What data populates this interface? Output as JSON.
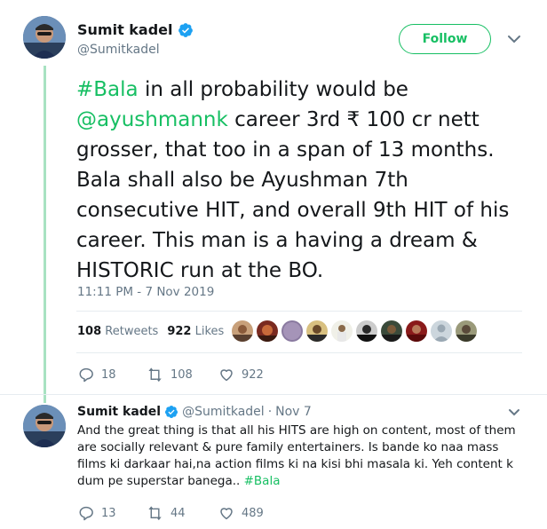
{
  "main_tweet": {
    "author_name": "Sumit kadel",
    "author_handle": "@Sumitkadel",
    "follow_label": "Follow",
    "text_parts": {
      "hashtag": "#Bala",
      "p1": " in all probability would be ",
      "mention": "@ayushmannk",
      "p2": " career 3rd ₹ 100 cr nett grosser, that too in a span of 13 months. Bala shall also be Ayushman 7th consecutive HIT, and overall 9th HIT of his career. This man is a having a dream & HISTORIC run at the BO."
    },
    "timestamp": "11:11 PM - 7 Nov 2019",
    "retweet_count": "108",
    "retweets_label": "Retweets",
    "like_count": "922",
    "likes_label": "Likes",
    "actions": {
      "replies": "18",
      "retweets": "108",
      "likes": "922"
    }
  },
  "reply_tweet": {
    "author_name": "Sumit kadel",
    "author_handle": "@Sumitkadel",
    "separator": "·",
    "date": "Nov 7",
    "text": "And the great thing is that all his HITS are high on content, most of them are socially relevant & pure family entertainers. Is bande ko naa mass films ki darkaar hai,na action films ki na kisi bhi masala ki. Yeh content k dum pe superstar banega.. ",
    "hashtag": "#Bala",
    "actions": {
      "replies": "13",
      "retweets": "44",
      "likes": "489"
    }
  },
  "colors": {
    "accent": "#17bf63",
    "verified": "#1da1f2",
    "muted": "#657786",
    "thread_line": "#a8e2c2"
  },
  "icons": [
    "verified-badge",
    "chevron-down-icon",
    "reply-icon",
    "retweet-icon",
    "heart-icon"
  ]
}
